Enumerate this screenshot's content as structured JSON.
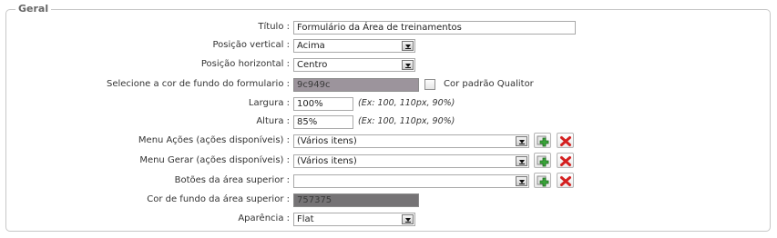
{
  "section": {
    "legend": "Geral"
  },
  "fields": {
    "titulo": {
      "label": "Título :",
      "value": "Formulário da Área de treinamentos"
    },
    "posicao_vertical": {
      "label": "Posição vertical :",
      "value": "Acima"
    },
    "posicao_horizontal": {
      "label": "Posição horizontal :",
      "value": "Centro"
    },
    "cor_fundo_formulario": {
      "label": "Selecione a cor de fundo do formulario :",
      "value": "9c949c",
      "color": "#9c949c",
      "checkbox_label": "Cor padrão Qualitor",
      "checkbox_checked": false
    },
    "largura": {
      "label": "Largura :",
      "value": "100%",
      "hint": "(Ex: 100, 110px, 90%)"
    },
    "altura": {
      "label": "Altura :",
      "value": "85%",
      "hint": "(Ex: 100, 110px, 90%)"
    },
    "menu_acoes": {
      "label": "Menu Ações (ações disponíveis) :",
      "value": "(Vários itens)"
    },
    "menu_gerar": {
      "label": "Menu Gerar (ações disponíveis) :",
      "value": "(Vários itens)"
    },
    "botoes_area_superior": {
      "label": "Botões da área superior :",
      "value": ""
    },
    "cor_fundo_area_superior": {
      "label": "Cor de fundo da área superior :",
      "value": "757375",
      "color": "#757375"
    },
    "aparencia": {
      "label": "Aparência :",
      "value": "Flat"
    }
  },
  "icons": {
    "add": "add-icon",
    "remove": "remove-icon",
    "dropdown": "dropdown-arrow-icon"
  },
  "colors": {
    "border": "#c7c7c7",
    "add_green": "#3aa53a",
    "remove_red": "#d42020"
  }
}
